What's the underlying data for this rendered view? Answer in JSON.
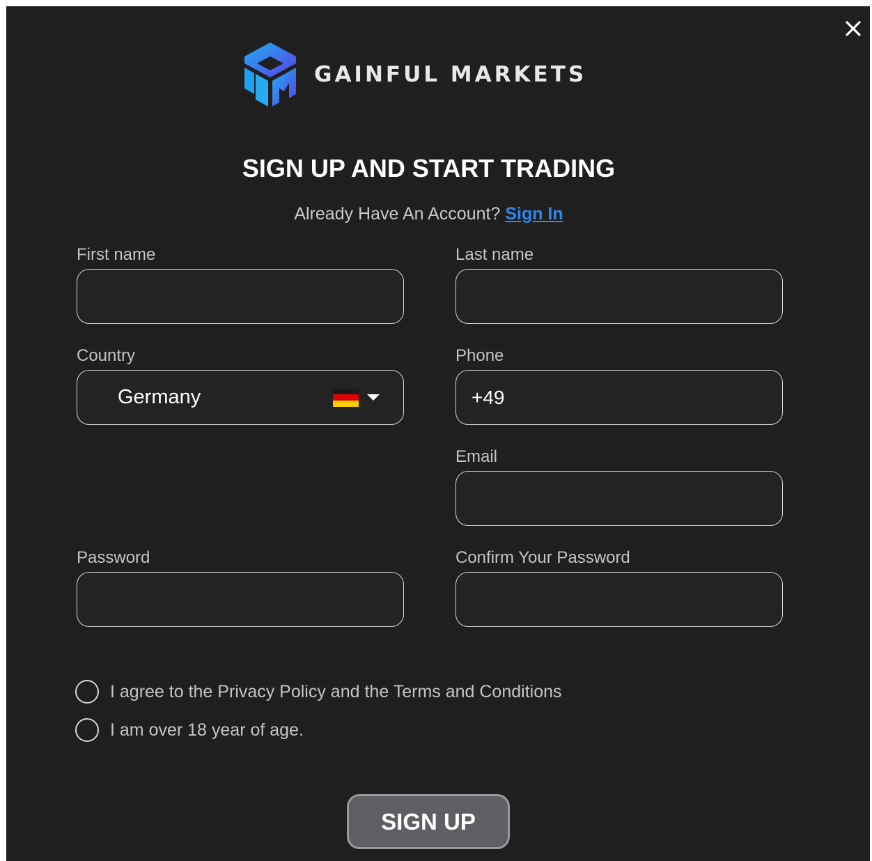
{
  "brand": {
    "name": "GAINFUL MARKETS",
    "logo_icon": "gm-cube-logo-icon",
    "gradient_colors": [
      "#1f9ff0",
      "#5b3fe6"
    ]
  },
  "title": "SIGN UP AND START TRADING",
  "account_prompt": {
    "text": "Already Have An Account?",
    "link_label": "Sign In",
    "link_color": "#2f86ec"
  },
  "fields": {
    "first_name": {
      "label": "First name",
      "value": ""
    },
    "last_name": {
      "label": "Last name",
      "value": ""
    },
    "country": {
      "label": "Country",
      "value": "Germany",
      "flag": "germany-flag-icon"
    },
    "phone": {
      "label": "Phone",
      "value": "+49"
    },
    "email": {
      "label": "Email",
      "value": ""
    },
    "password": {
      "label": "Password",
      "value": ""
    },
    "confirm_password": {
      "label": "Confirm Your Password",
      "value": ""
    }
  },
  "consents": {
    "privacy": {
      "label": "I agree to the Privacy Policy and the Terms and Conditions",
      "checked": false
    },
    "age": {
      "label": "I am over 18 year of age.",
      "checked": false
    }
  },
  "submit_label": "SIGN UP",
  "close_icon": "close-icon",
  "colors": {
    "background": "#1f1f20",
    "field_border": "#d6d6d9",
    "button_bg": "#5f5f63"
  }
}
